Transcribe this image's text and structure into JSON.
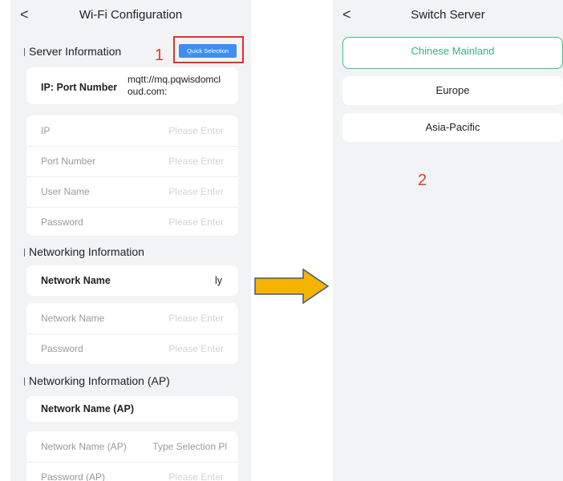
{
  "left": {
    "title": "Wi-Fi Configuration",
    "back_glyph": "<",
    "quick_selection": "Quick Selection",
    "annotation_1": "1",
    "server_section": "Server Information",
    "ip_port_label": "IP: Port Number",
    "ip_port_value": "mqtt://mq.pqwisdomcloud.com:",
    "server_rows": [
      {
        "label": "IP",
        "placeholder": "Please Enter"
      },
      {
        "label": "Port Number",
        "placeholder": "Please Enter"
      },
      {
        "label": "User Name",
        "placeholder": "Please Enter"
      },
      {
        "label": "Password",
        "placeholder": "Please Enter"
      }
    ],
    "network_section": "Networking Information",
    "network_name_label": "Network Name",
    "network_name_value": "ly",
    "network_rows": [
      {
        "label": "Network Name",
        "placeholder": "Please Enter"
      },
      {
        "label": "Password",
        "placeholder": "Please Enter"
      }
    ],
    "ap_section": "Networking Information (AP)",
    "ap_name_label": "Network Name (AP)",
    "ap_rows": [
      {
        "label": "Network Name (AP)",
        "placeholder": "Type Selection  Pl"
      },
      {
        "label": "Password (AP)",
        "placeholder": "Please Enter"
      }
    ]
  },
  "right": {
    "title": "Switch Server",
    "back_glyph": "<",
    "options": [
      "Chinese Mainland",
      "Europe",
      "Asia-Pacific"
    ],
    "selected": "Chinese Mainland",
    "annotation_2": "2"
  },
  "colors": {
    "accent_blue": "#3d8ef0",
    "selected_green": "#33b57e",
    "annotation_red": "#e23030",
    "arrow_fill": "#f5b400",
    "arrow_stroke": "#3b5a8a"
  },
  "icons": [
    "back-arrow-icon",
    "right-arrow-icon"
  ]
}
